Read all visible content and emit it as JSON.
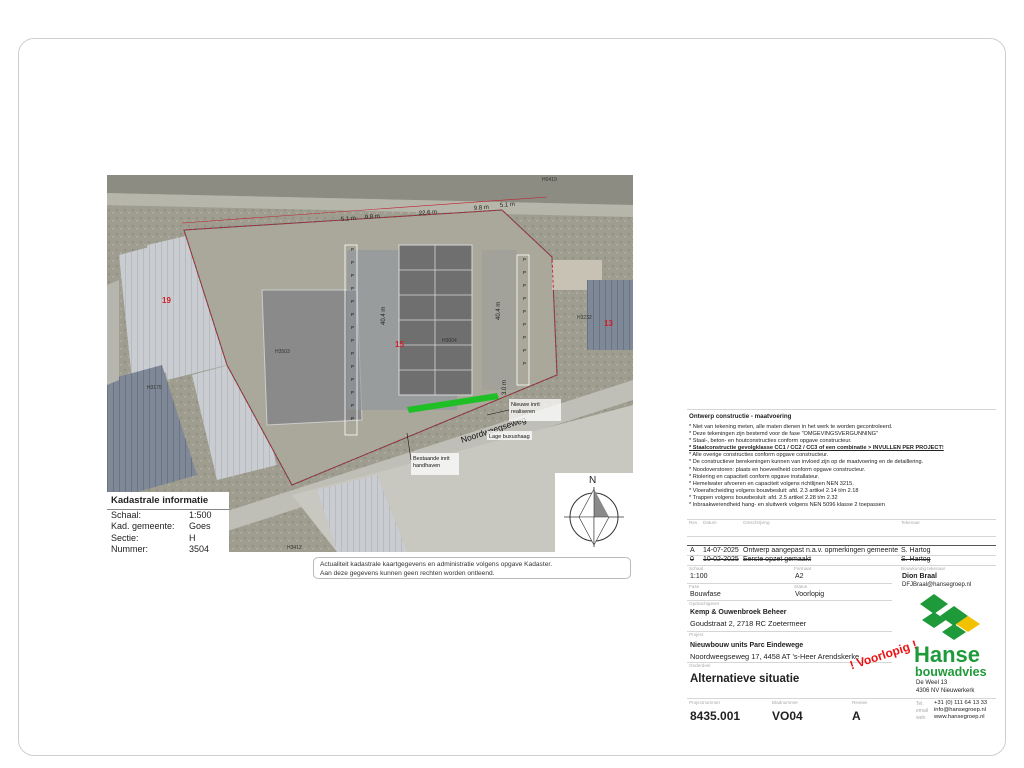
{
  "map": {
    "labels": {
      "plot_19": "19",
      "plot_15": "15",
      "plot_13": "13",
      "h3503": "H3503",
      "h3175": "H3175",
      "h3412": "H3412",
      "h3004": "H3004",
      "h3232": "H3232",
      "h0419": "H0419",
      "road": "Noordweegseweg",
      "dim_51a": "5.1 m",
      "dim_98a": "9.8 m",
      "dim_226": "22.6 m",
      "dim_98b": "9.8 m",
      "dim_51b": "5.1 m",
      "dim_40a": "40.4 m",
      "dim_40b": "40.4 m",
      "dim_30": "3.0 m",
      "callout_new": "Nieuwe inrit realiseren",
      "callout_existing": "Bestaande inrit handhaven",
      "callout_hedge": "Lage buxushaag",
      "parking_p": "P",
      "north": "N"
    }
  },
  "kadaster": {
    "title": "Kadastrale informatie",
    "rows": [
      {
        "k": "Schaal:",
        "v": "1:500"
      },
      {
        "k": "Kad. gemeente:",
        "v": "Goes"
      },
      {
        "k": "Sectie:",
        "v": "H"
      },
      {
        "k": "Nummer:",
        "v": "3504"
      }
    ]
  },
  "cadastral_note": {
    "line1": "Actualiteit kadastrale kaartgegevens en administratie volgens opgave Kadaster.",
    "line2": "Aan deze gegevens kunnen geen rechten worden ontleend."
  },
  "titleblock": {
    "notes_title": "Ontwerp constructie - maatvoering",
    "notes": [
      "* Niet van tekening meten, alle maten dienen in het werk te worden gecontroleerd.",
      "* Deze tekeningen zijn bestemd voor de fase \"OMGEVINGSVERGUNNING\"",
      "* Staal-, beton- en houtconstructies conform opgave constructeur.",
      "* Staalconstructie gevolgklasse CC1 / CC2 / CC3 of een combinatie > INVULLEN PER PROJECT!",
      "* Alle overige constructies conform opgave constructeur.",
      "* De constructieve berekeningen kunnen van invloed zijn op de maatvoering en de detaillering.",
      "* Noodoverstoren: plaats en hoeveelheid conform opgave constructeur.",
      "* Riolering en capaciteit conform opgave installateur.",
      "* Hemelwater afvoeren en capaciteit volgens richtlijnen NEN 3215.",
      "* Vloerafscheiding volgens bouwbesluit: afd. 2.3 artikel 2.14 t/m 2.18",
      "* Trappen volgens bouwbesluit: afd. 2.5 artikel 2.28 t/m 2.32",
      "* Inbraakwerendheid hang- en sluitwerk volgens NEN 5096 klasse 2 toepassen"
    ],
    "rev_headers": {
      "rev": "Rev.",
      "datum": "Datum",
      "omschrijving": "Omschrijving",
      "tekenaar": "Tekenaar"
    },
    "revisions": [
      {
        "rev": "A",
        "datum": "14-07-2025",
        "omschrijving": "Ontwerp aangepast n.a.v. opmerkingen gemeente",
        "tekenaar": "S. Hartog"
      },
      {
        "rev": "0",
        "datum": "10-02-2025",
        "omschrijving": "Eerste opzet gemaakt",
        "tekenaar": "S. Hartog"
      }
    ],
    "schaal_label": "Schaal",
    "schaal": "1:100",
    "formaat_label": "Formaat",
    "formaat": "A2",
    "bouwkundig_label": "Bouwkundig tekenaar",
    "tekenaar_name": "Dion Braal",
    "tekenaar_email": "DFJBraal@hansegroep.nl",
    "fase_label": "Fase",
    "fase": "Bouwfase",
    "status_label": "Status",
    "status": "Voorlopig",
    "opdrachtgever_label": "Opdrachtgever",
    "opdrachtgever": "Kemp & Ouwenbroek Beheer",
    "opdrachtgever_adres": "Goudstraat 2, 2718 RC Zoetermeer",
    "project_label": "Project",
    "project": "Nieuwbouw units Parc Eindewege",
    "project_adres": "Noordweegseweg 17, 4458 AT 's-Heer Arendskerke",
    "onderdeel_label": "Onderdeel",
    "onderdeel": "Alternatieve situatie",
    "projectnummer_label": "Projectnummer",
    "projectnummer": "8435.001",
    "bladnummer_label": "Bladnummer",
    "bladnummer": "VO04",
    "revisie_label": "Revisie",
    "revisie": "A",
    "stamp": "! Voorlopig !",
    "company_1": "Hanse",
    "company_2": "bouwadvies",
    "address_1": "De Weel 13",
    "address_2": "4306 NV Nieuwerkerk",
    "tel_label": "Tel.",
    "tel": "+31 (0) 111 64 13 33",
    "email_label": "email",
    "email": "info@hansegroep.nl",
    "web_label": "web",
    "web": "www.hansegroep.nl"
  },
  "colors": {
    "logo_green": "#1f9a3a",
    "logo_yellow": "#f2c100",
    "stamp_red": "#e01111",
    "plot_red": "#d0202a"
  }
}
